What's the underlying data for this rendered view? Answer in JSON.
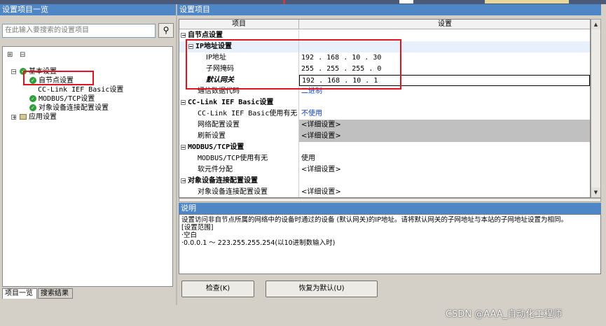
{
  "left_panel": {
    "title": "设置项目一览",
    "search_placeholder": "在此输入要搜索的设置项目",
    "tree": [
      {
        "label": "基本设置"
      },
      {
        "label": "自节点设置"
      },
      {
        "label": "CC-Link IEF Basic设置"
      },
      {
        "label": "MODBUS/TCP设置"
      },
      {
        "label": "对象设备连接配置设置"
      },
      {
        "label": "应用设置"
      }
    ],
    "tabs": [
      "项目一览",
      "搜索结果"
    ]
  },
  "right_panel": {
    "title": "设置项目",
    "columns": [
      "项目",
      "设置"
    ],
    "rows": [
      {
        "item": "自节点设置",
        "value": ""
      },
      {
        "item": "IP地址设置",
        "value": ""
      },
      {
        "item": "IP地址",
        "value": "192 . 168 . 10 . 30"
      },
      {
        "item": "子网掩码",
        "value": "255 . 255 . 255 . 0"
      },
      {
        "item": "默认网关",
        "value": "192 . 168 . 10 . 1"
      },
      {
        "item": "通信数据代码",
        "value": "二进制"
      },
      {
        "item": "CC-Link IEF Basic设置",
        "value": ""
      },
      {
        "item": "CC-Link IEF Basic使用有无",
        "value": "不使用"
      },
      {
        "item": "网络配置设置",
        "value": "<详细设置>"
      },
      {
        "item": "刷新设置",
        "value": "<详细设置>"
      },
      {
        "item": "MODBUS/TCP设置",
        "value": ""
      },
      {
        "item": "MODBUS/TCP使用有无",
        "value": "使用"
      },
      {
        "item": "软元件分配",
        "value": "<详细设置>"
      },
      {
        "item": "对象设备连接配置设置",
        "value": ""
      },
      {
        "item": "对象设备连接配置设置",
        "value": "<详细设置>"
      }
    ]
  },
  "description": {
    "title": "说明",
    "lines": [
      "设置访问非自节点所属的网络中的设备时通过的设备 (默认网关)的IP地址。请将默认网关的子网地址与本站的子网地址设置为相同。",
      "[设置范围]",
      "·空白",
      "·0.0.0.1 ～ 223.255.255.254(以10进制数输入时)"
    ]
  },
  "buttons": {
    "check": "检查(K)",
    "restore_default": "恢复为默认(U)"
  },
  "watermark": "CSDN @AAA_自动化工程师",
  "colors": {
    "title_bar": "#4f86c6",
    "highlight_box": "#e0141e",
    "value_blue": "#1040c0",
    "disabled_cell": "#c0c0c0"
  }
}
